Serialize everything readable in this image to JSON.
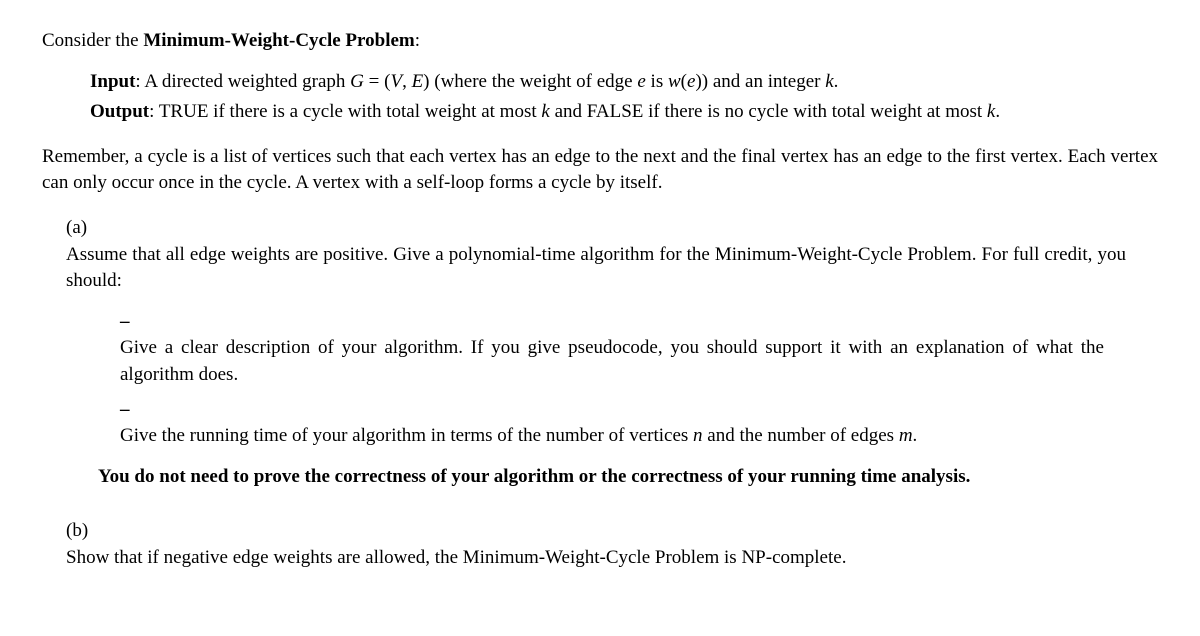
{
  "intro_prefix": "Consider the ",
  "intro_bold": "Minimum-Weight-Cycle Problem",
  "intro_suffix": ":",
  "input_label": "Input",
  "input_text_1": ": A directed weighted graph ",
  "input_G": "G",
  "input_eq": " = (",
  "input_V": "V",
  "input_comma": ", ",
  "input_E": "E",
  "input_text_2": ") (where the weight of edge ",
  "input_e": "e",
  "input_text_3": " is ",
  "input_w": "w",
  "input_text_4": "(",
  "input_e2": "e",
  "input_text_5": ")) and an integer ",
  "input_k": "k",
  "input_text_6": ".",
  "output_label": "Output",
  "output_text_1": ": TRUE if there is a cycle with total weight at most ",
  "output_k1": "k",
  "output_text_2": " and FALSE if there is no cycle with total weight at most ",
  "output_k2": "k",
  "output_text_3": ".",
  "remember": "Remember, a cycle is a list of vertices such that each vertex has an edge to the next and the final vertex has an edge to the first vertex. Each vertex can only occur once in the cycle. A vertex with a self-loop forms a cycle by itself.",
  "part_a_label": "(a)",
  "part_a_text": "Assume that all edge weights are positive. Give a polynomial-time algorithm for the Minimum-Weight-Cycle Problem. For full credit, you should:",
  "bullet_1": "Give a clear description of your algorithm. If you give pseudocode, you should support it with an explanation of what the algorithm does.",
  "bullet_2_text_1": "Give the running time of your algorithm in terms of the number of vertices ",
  "bullet_2_n": "n",
  "bullet_2_text_2": " and the number of edges ",
  "bullet_2_m": "m",
  "bullet_2_text_3": ".",
  "bold_note": "You do not need to prove the correctness of your algorithm or the correctness of your running time analysis.",
  "part_b_label": "(b)",
  "part_b_text": "Show that if negative edge weights are allowed, the Minimum-Weight-Cycle Problem is NP-complete.",
  "dash": "–"
}
